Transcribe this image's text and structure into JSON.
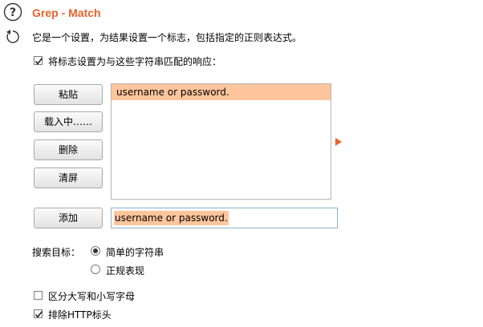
{
  "header": {
    "title": "Grep - Match",
    "description": "它是一个设置，为结果设置一个标志，包括指定的正则表达式。"
  },
  "flag_checkbox": {
    "label": "将标志设置为与这些字符串匹配的响应：",
    "checked": true
  },
  "buttons": {
    "paste": "粘贴",
    "load": "载入中……",
    "remove": "删除",
    "clear": "清屏",
    "add": "添加"
  },
  "list": {
    "items": [
      "username or password."
    ]
  },
  "input": {
    "value": "username or password."
  },
  "search_target": {
    "label": "搜索目标：",
    "options": [
      {
        "label": "简单的字符串",
        "selected": true
      },
      {
        "label": "正规表现",
        "selected": false
      }
    ]
  },
  "options": {
    "case_sensitive": {
      "label": "区分大写和小写字母",
      "checked": false
    },
    "exclude_http_headers": {
      "label": "排除HTTP标头",
      "checked": true
    }
  },
  "colors": {
    "accent": "#e8622a",
    "selection": "#ffc59c"
  },
  "icons": {
    "help": "help-icon",
    "refresh": "refresh-icon",
    "arrow": "triangle-right-icon"
  }
}
